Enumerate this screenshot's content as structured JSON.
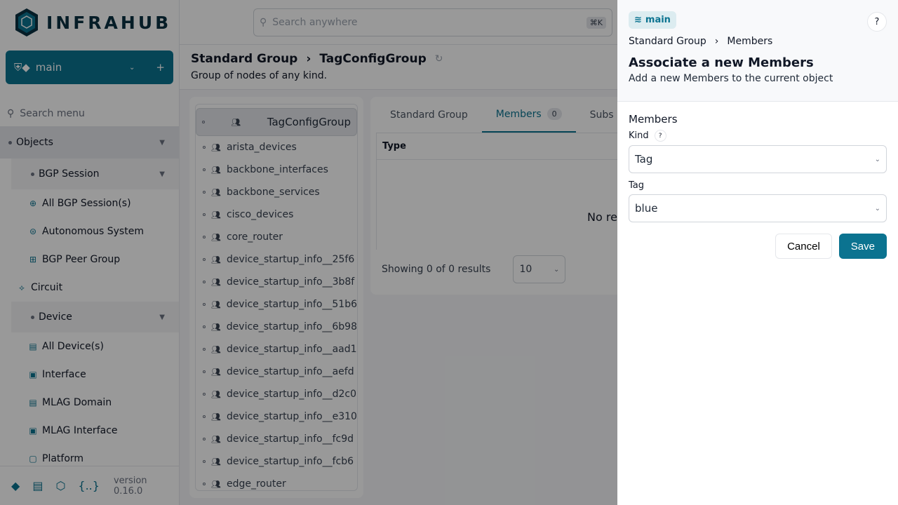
{
  "app": {
    "name": "INFRAHUB",
    "version": "version 0.16.0"
  },
  "branch": {
    "name": "main"
  },
  "sidebar": {
    "search_placeholder": "Search menu",
    "items": [
      {
        "label": "Objects",
        "level": 0
      },
      {
        "label": "BGP Session",
        "level": 1
      },
      {
        "label": "All BGP Session(s)",
        "level": 2,
        "icon": "globe-icon"
      },
      {
        "label": "Autonomous System",
        "level": 2,
        "icon": "as-icon"
      },
      {
        "label": "BGP Peer Group",
        "level": 2,
        "icon": "group-icon"
      },
      {
        "label": "Circuit",
        "level": "1b",
        "icon": "circuit-icon"
      },
      {
        "label": "Device",
        "level": 1
      },
      {
        "label": "All Device(s)",
        "level": 2,
        "icon": "server-icon"
      },
      {
        "label": "Interface",
        "level": 2,
        "icon": "ethernet-icon"
      },
      {
        "label": "MLAG Domain",
        "level": 2,
        "icon": "server-icon"
      },
      {
        "label": "MLAG Interface",
        "level": 2,
        "icon": "ethernet-icon"
      },
      {
        "label": "Platform",
        "level": 2,
        "icon": "platform-icon"
      }
    ]
  },
  "header": {
    "search_placeholder": "Search anywhere",
    "shortcut": "⌘K"
  },
  "page": {
    "kind": "Standard Group",
    "name": "TagConfigGroup",
    "description": "Group of nodes of any kind."
  },
  "groups": [
    "TagConfigGroup",
    "arista_devices",
    "backbone_interfaces",
    "backbone_services",
    "cisco_devices",
    "core_router",
    "device_startup_info__25f6",
    "device_startup_info__3b8f",
    "device_startup_info__51b6",
    "device_startup_info__6b98",
    "device_startup_info__aad1",
    "device_startup_info__aefd",
    "device_startup_info__d2c0",
    "device_startup_info__e310",
    "device_startup_info__fc9d",
    "device_startup_info__fcb6",
    "edge_router"
  ],
  "tabs": [
    {
      "label": "Standard Group"
    },
    {
      "label": "Members",
      "count": "0"
    },
    {
      "label": "Subs"
    }
  ],
  "table": {
    "column": "Type",
    "empty": "No re",
    "showing": "Showing 0 of 0 results",
    "page_size": "10"
  },
  "drawer": {
    "branch": "main",
    "help": "?",
    "breadcrumb": [
      "Standard Group",
      "Members"
    ],
    "title": "Associate a new Members",
    "subtitle": "Add a new Members to the current object",
    "section": "Members",
    "kind_label": "Kind",
    "kind_value": "Tag",
    "tag_label": "Tag",
    "tag_value": "blue",
    "cancel": "Cancel",
    "save": "Save"
  },
  "colors": {
    "accent": "#0b7390"
  }
}
